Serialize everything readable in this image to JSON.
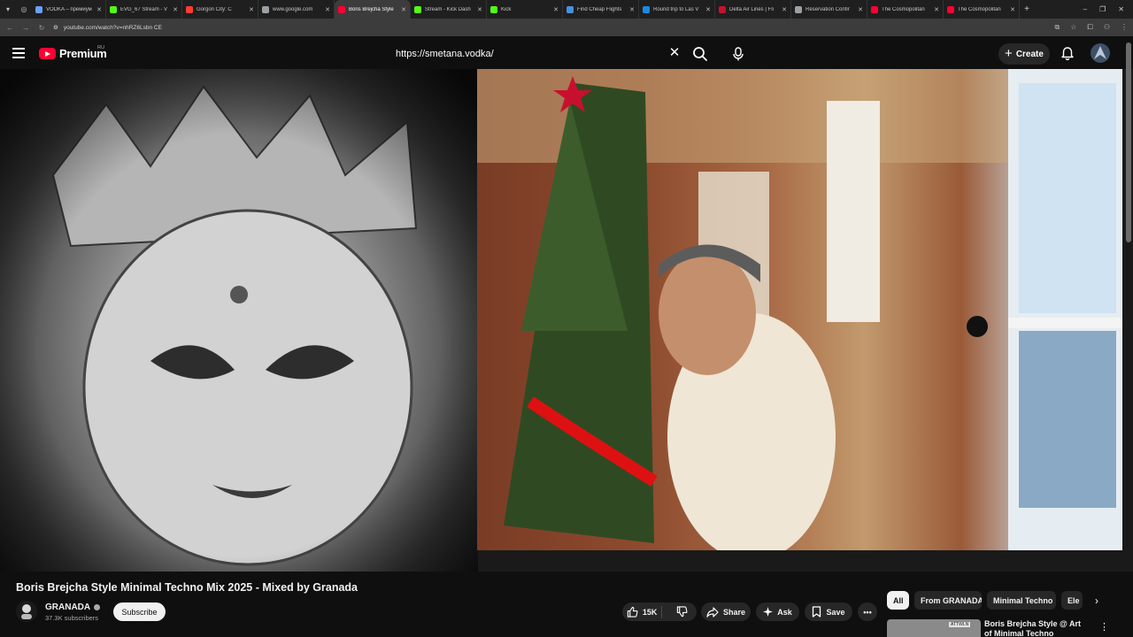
{
  "browser": {
    "tabs": [
      {
        "title": "VODKA – премиум",
        "color": "#6aa0ff",
        "active": false
      },
      {
        "title": "EVG_67 Stream - V",
        "color": "#53fc18",
        "active": false
      },
      {
        "title": "Gorgon City: C",
        "color": "#ff3b30",
        "active": false
      },
      {
        "title": "www.google.com",
        "color": "#9aa0a6",
        "active": false
      },
      {
        "title": "Boris Brejcha Style",
        "color": "#ff0033",
        "active": true
      },
      {
        "title": "Stream - Kick Dash",
        "color": "#53fc18",
        "active": false
      },
      {
        "title": "Kick",
        "color": "#53fc18",
        "active": false
      },
      {
        "title": "Find Cheap Flights",
        "color": "#4a90e2",
        "active": false
      },
      {
        "title": "Round trip to Las V",
        "color": "#1e88e5",
        "active": false
      },
      {
        "title": "Delta Air Lines | Fli",
        "color": "#c8102e",
        "active": false
      },
      {
        "title": "Reservation Confir",
        "color": "#9aa0a6",
        "active": false
      },
      {
        "title": "The Cosmopolitan",
        "color": "#ff0033",
        "active": false
      },
      {
        "title": "The Cosmopolitan",
        "color": "#ff0033",
        "active": false
      }
    ],
    "url": "youtube.com/watch?v=nhRZ6Lsbn CE"
  },
  "header": {
    "logo_text": "Premium",
    "country_code": "RU",
    "search_value": "https://smetana.vodka/",
    "create_label": "Create"
  },
  "video": {
    "title": "Boris Brejcha Style Minimal Techno Mix 2025 - Mixed by Granada",
    "channel": "GRANADA",
    "subscribers": "37.3K subscribers",
    "subscribe_label": "Subscribe",
    "likes": "15K",
    "share_label": "Share",
    "ask_label": "Ask",
    "save_label": "Save"
  },
  "chips": [
    "All",
    "From GRANADA",
    "Minimal Techno",
    "Ele"
  ],
  "recommendation": {
    "title": "Boris Brejcha Style @ Art of Minimal Techno Cartoon",
    "thumb_label": "ATTWLN"
  }
}
